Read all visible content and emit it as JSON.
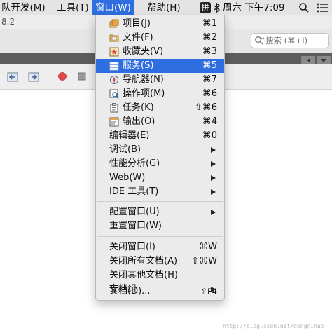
{
  "menubar": {
    "items": [
      "队开发(M)",
      "工具(T)",
      "窗口(W)",
      "帮助(H)"
    ],
    "ime_label": "拼",
    "clock": "周六 下午7:09"
  },
  "ide": {
    "version_fragment": "8.2",
    "search_placeholder": "搜索 (⌘+I)"
  },
  "menu": {
    "items": [
      {
        "label": "项目(J)",
        "shortcut": "⌘1",
        "icon": "projects-icon"
      },
      {
        "label": "文件(F)",
        "shortcut": "⌘2",
        "icon": "files-icon"
      },
      {
        "label": "收藏夹(V)",
        "shortcut": "⌘3",
        "icon": "favorites-icon"
      },
      {
        "label": "服务(S)",
        "shortcut": "⌘5",
        "icon": "services-icon",
        "highlighted": true
      },
      {
        "label": "导航器(N)",
        "shortcut": "⌘7",
        "icon": "navigator-icon"
      },
      {
        "label": "操作项(M)",
        "shortcut": "⌘6",
        "icon": "action-items-icon"
      },
      {
        "label": "任务(K)",
        "shortcut": "⇧⌘6",
        "icon": "tasks-icon"
      },
      {
        "label": "输出(O)",
        "shortcut": "⌘4",
        "icon": "output-icon"
      },
      {
        "label": "编辑器(E)",
        "shortcut": "⌘0"
      },
      {
        "label": "调试(B)",
        "submenu": true
      },
      {
        "label": "性能分析(G)",
        "submenu": true
      },
      {
        "label": "Web(W)",
        "submenu": true
      },
      {
        "label": "IDE 工具(T)",
        "submenu": true
      },
      {
        "label": "配置窗口(U)",
        "submenu": true
      },
      {
        "label": "重置窗口(W)"
      },
      {
        "label": "关闭窗口(I)",
        "shortcut": "⌘W"
      },
      {
        "label": "关闭所有文档(A)",
        "shortcut": "⇧⌘W"
      },
      {
        "label": "关闭其他文档(H)"
      },
      {
        "label": "文档组",
        "submenu": true
      },
      {
        "label": "文档(D)...",
        "shortcut": "⇧F4"
      }
    ]
  },
  "watermark": "http://blog.csdn.net/dongnihao",
  "colors": {
    "highlight": "#2f6ee0",
    "menu_bg": "#ebebeb",
    "menubar_bg": "#e4e4e4"
  }
}
